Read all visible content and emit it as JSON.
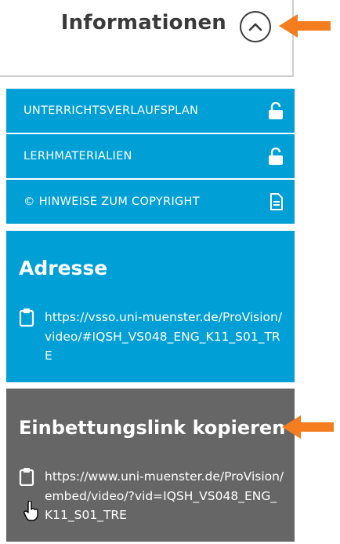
{
  "header": {
    "title": "Informationen"
  },
  "nav": {
    "items": [
      {
        "label": "UNTERRICHTSVERLAUFSPLAN",
        "icon": "unlock-icon"
      },
      {
        "label": "LERHMATERIALIEN",
        "icon": "unlock-icon"
      },
      {
        "label": "© HINWEISE ZUM COPYRIGHT",
        "icon": "document-icon"
      }
    ]
  },
  "address": {
    "heading": "Adresse",
    "url": "https://vsso.uni-muenster.de/ProVision/video/#IQSH_VS048_ENG_K11_S01_TRE"
  },
  "embed": {
    "heading": "Einbettungslink kopieren",
    "url": "https://www.uni-muenster.de/ProVision/embed/video/?vid=IQSH_VS048_ENG_K11_S01_TRE"
  },
  "colors": {
    "accent_blue": "#009fd6",
    "embed_gray": "#666666",
    "arrow_orange": "#f47d20",
    "title_dark": "#3a3a3a"
  }
}
